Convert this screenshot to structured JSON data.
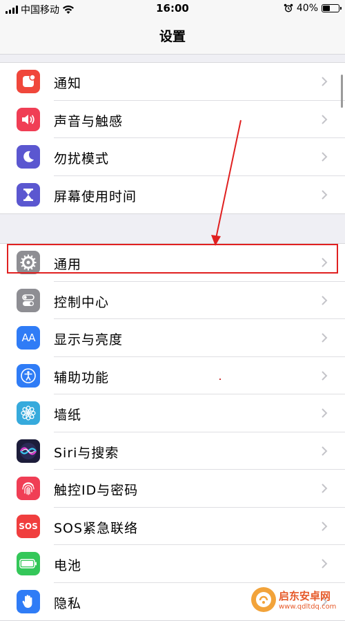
{
  "status_bar": {
    "carrier": "中国移动",
    "time": "16:00",
    "battery": "40%"
  },
  "nav": {
    "title": "设置"
  },
  "groups": [
    {
      "items": [
        {
          "label": "通知",
          "icon": "notifications-icon",
          "color": "#f0473b"
        },
        {
          "label": "声音与触感",
          "icon": "sound-icon",
          "color": "#f03e55"
        },
        {
          "label": "勿扰模式",
          "icon": "do-not-disturb-moon-icon",
          "color": "#5b57d0"
        },
        {
          "label": "屏幕使用时间",
          "icon": "screen-time-hourglass-icon",
          "color": "#5b57d0"
        }
      ]
    },
    {
      "items": [
        {
          "label": "通用",
          "icon": "gear-icon",
          "color": "#8e8e93"
        },
        {
          "label": "控制中心",
          "icon": "control-center-icon",
          "color": "#8e8e93"
        },
        {
          "label": "显示与亮度",
          "icon": "display-brightness-icon",
          "color": "#2f7cf6",
          "icon_text": "AA"
        },
        {
          "label": "辅助功能",
          "icon": "accessibility-icon",
          "color": "#2f7cf6"
        },
        {
          "label": "墙纸",
          "icon": "wallpaper-flower-icon",
          "color": "#36aadc"
        },
        {
          "label": "Siri与搜索",
          "icon": "siri-icon",
          "color": "#1c1c3a"
        },
        {
          "label": "触控ID与密码",
          "icon": "touch-id-fingerprint-icon",
          "color": "#f03e55"
        },
        {
          "label": "SOS紧急联络",
          "icon": "sos-icon",
          "color": "#f03e3e",
          "icon_text": "SOS"
        },
        {
          "label": "电池",
          "icon": "battery-icon",
          "color": "#34c759"
        },
        {
          "label": "隐私",
          "icon": "privacy-hand-icon",
          "color": "#2f7cf6"
        }
      ]
    }
  ],
  "watermark": {
    "title": "启东安卓网",
    "url": "www.qdltdq.com"
  }
}
